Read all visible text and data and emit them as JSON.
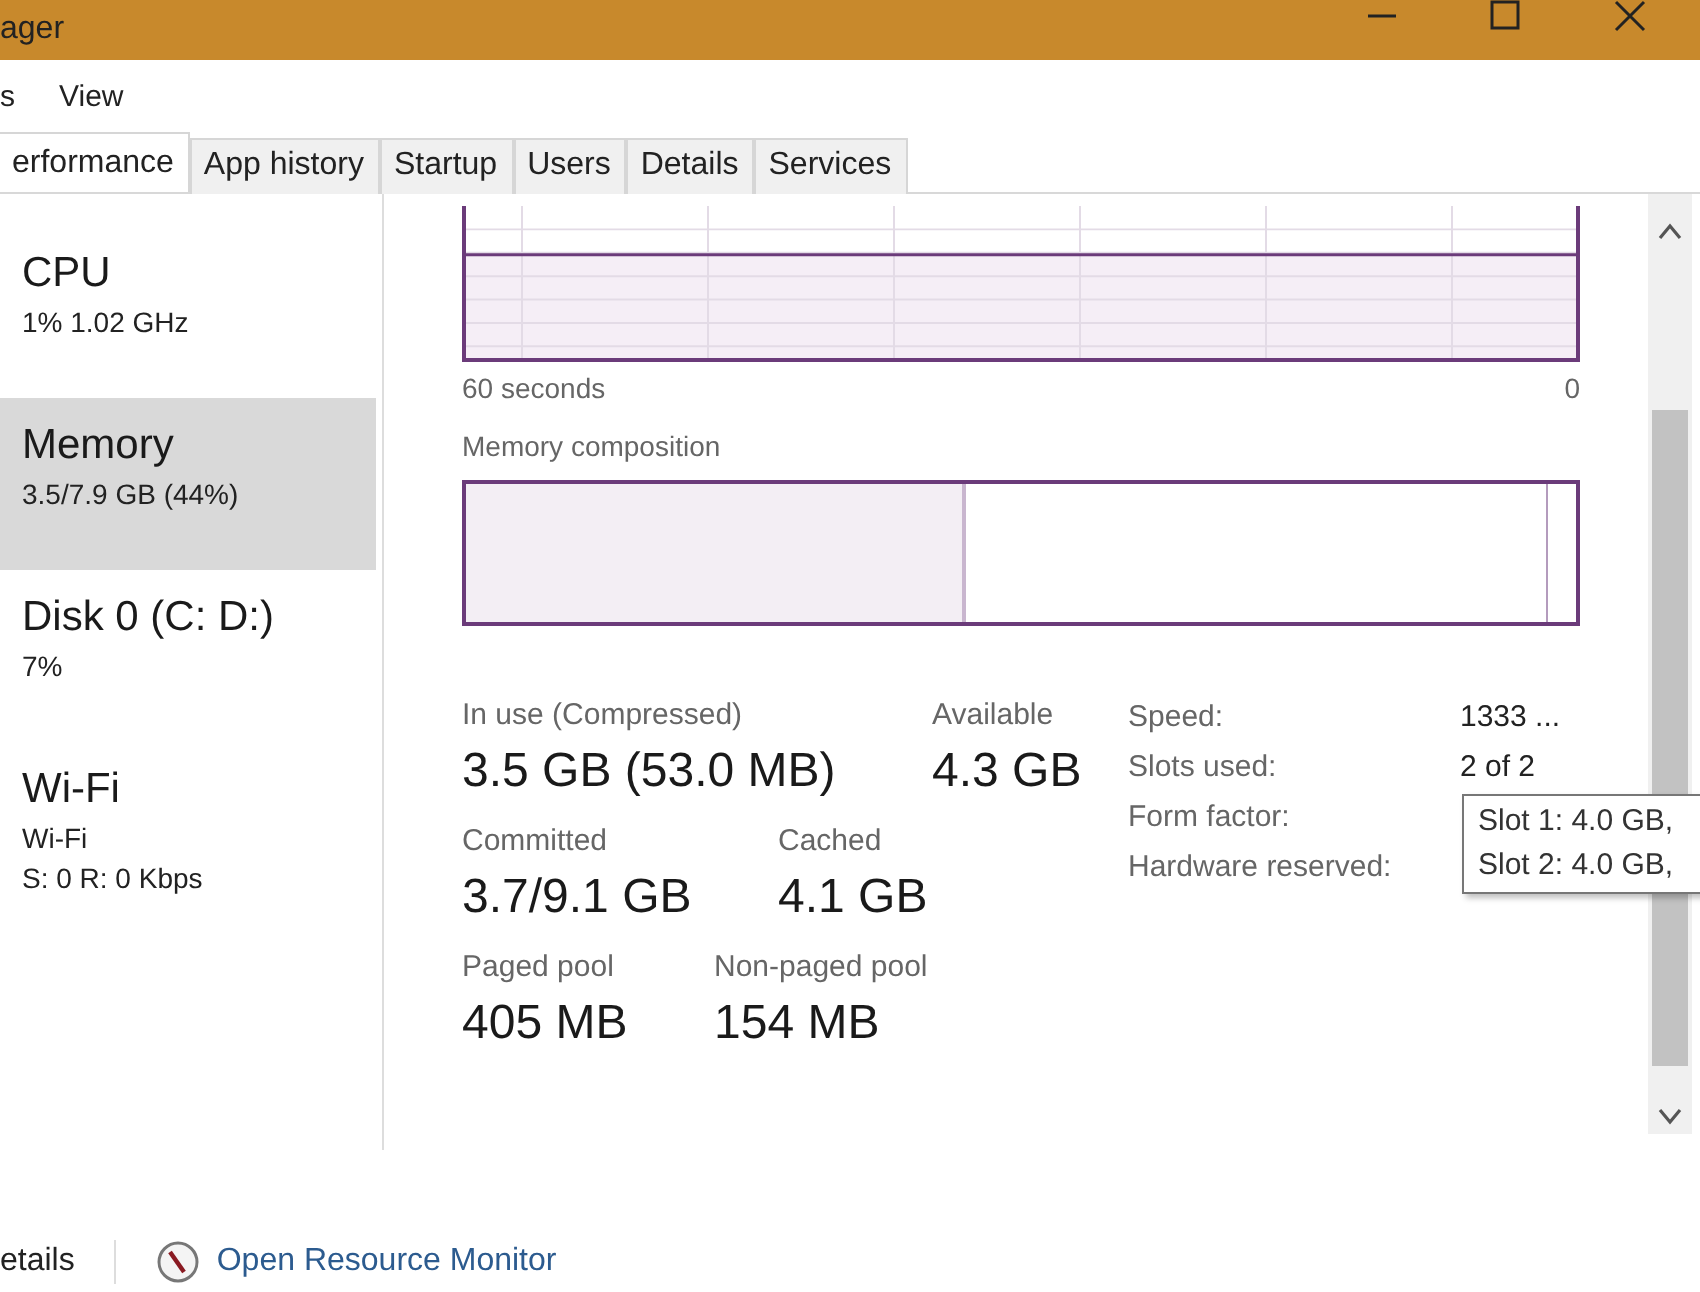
{
  "window": {
    "title": "ager"
  },
  "menu": [
    "s",
    "View"
  ],
  "tabs": [
    {
      "label": "erformance",
      "selected": true
    },
    {
      "label": "App history",
      "selected": false
    },
    {
      "label": "Startup",
      "selected": false
    },
    {
      "label": "Users",
      "selected": false
    },
    {
      "label": "Details",
      "selected": false
    },
    {
      "label": "Services",
      "selected": false
    }
  ],
  "sidebar": {
    "items": [
      {
        "name": "CPU",
        "lines": [
          "1% 1.02 GHz"
        ],
        "selected": false
      },
      {
        "name": "Memory",
        "lines": [
          "3.5/7.9 GB (44%)"
        ],
        "selected": true
      },
      {
        "name": "Disk 0 (C: D:)",
        "lines": [
          "7%"
        ],
        "selected": false
      },
      {
        "name": "Wi-Fi",
        "lines": [
          "Wi-Fi",
          "S: 0 R: 0 Kbps"
        ],
        "selected": false
      }
    ]
  },
  "usage_graph": {
    "time_start": "60 seconds",
    "time_end": "0"
  },
  "composition": {
    "title": "Memory composition",
    "level": 0.45
  },
  "stats": [
    [
      {
        "label": "In use (Compressed)",
        "value": "3.5 GB (53.0 MB)"
      },
      {
        "label": "Available",
        "value": "4.3 GB"
      }
    ],
    [
      {
        "label": "Committed",
        "value": "3.7/9.1 GB"
      },
      {
        "label": "Cached",
        "value": "4.1 GB"
      }
    ],
    [
      {
        "label": "Paged pool",
        "value": "405 MB"
      },
      {
        "label": "Non-paged pool",
        "value": "154 MB"
      }
    ]
  ],
  "details": [
    {
      "label": "Speed:",
      "value": "1333 ..."
    },
    {
      "label": "Slots used:",
      "value": "2 of 2"
    },
    {
      "label": "Form factor:"
    },
    {
      "label": "Hardware reserved:"
    }
  ],
  "tooltip": [
    "Slot 1: 4.0 GB, ",
    "Slot 2: 4.0 GB, "
  ],
  "footer": {
    "details_link": "etails",
    "monitor_link": "Open Resource Monitor"
  }
}
